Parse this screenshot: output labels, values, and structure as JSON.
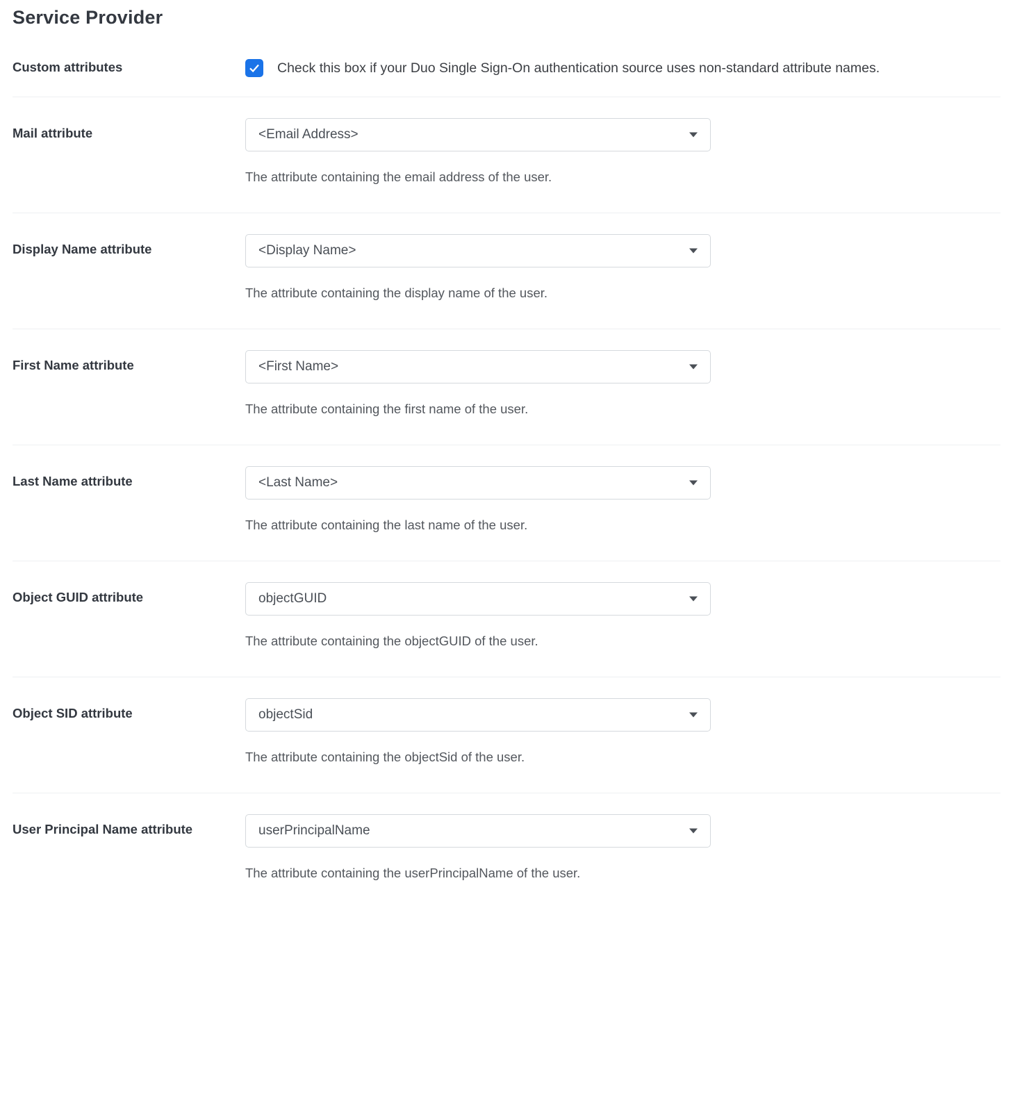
{
  "section_title": "Service Provider",
  "custom_attributes": {
    "label": "Custom attributes",
    "checked": true,
    "description": "Check this box if your Duo Single Sign-On authentication source uses non-standard attribute names."
  },
  "fields": [
    {
      "label": "Mail attribute",
      "value": "<Email Address>",
      "help": "The attribute containing the email address of the user."
    },
    {
      "label": "Display Name attribute",
      "value": "<Display Name>",
      "help": "The attribute containing the display name of the user."
    },
    {
      "label": "First Name attribute",
      "value": "<First Name>",
      "help": "The attribute containing the first name of the user."
    },
    {
      "label": "Last Name attribute",
      "value": "<Last Name>",
      "help": "The attribute containing the last name of the user."
    },
    {
      "label": "Object GUID attribute",
      "value": "objectGUID",
      "help": "The attribute containing the objectGUID of the user."
    },
    {
      "label": "Object SID attribute",
      "value": "objectSid",
      "help": "The attribute containing the objectSid of the user."
    },
    {
      "label": "User Principal Name attribute",
      "value": "userPrincipalName",
      "help": "The attribute containing the userPrincipalName of the user."
    }
  ]
}
